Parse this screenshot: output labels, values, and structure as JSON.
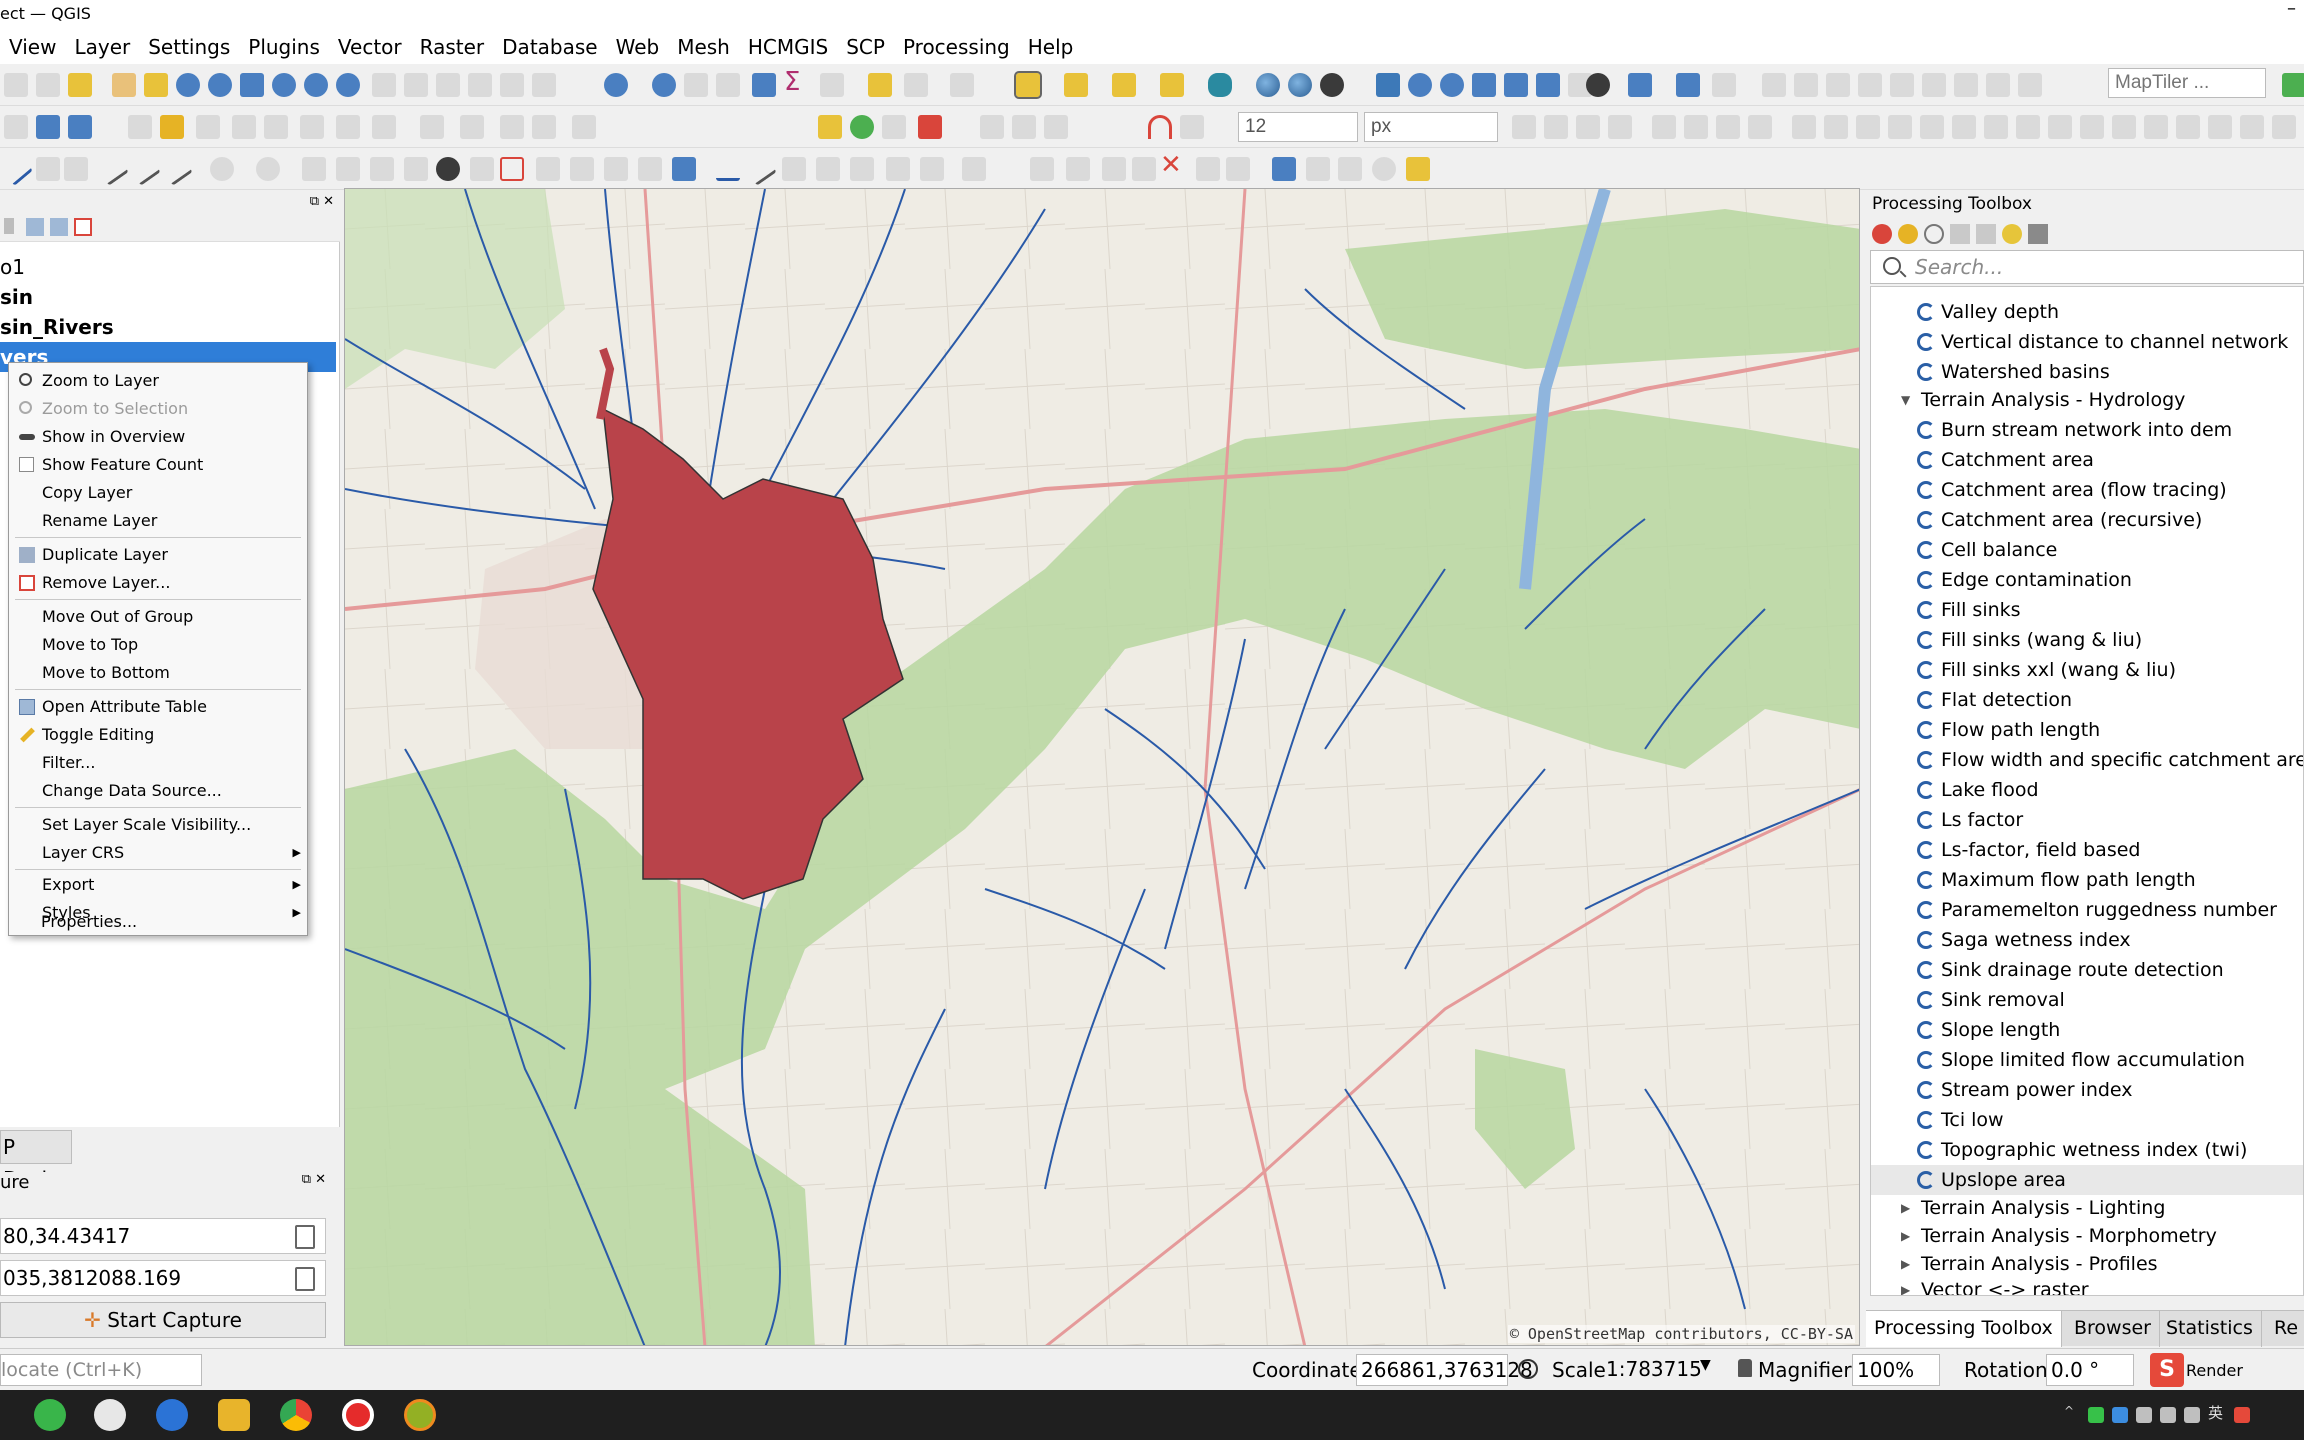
{
  "window": {
    "title": "ect — QGIS"
  },
  "menu": [
    "View",
    "Layer",
    "Settings",
    "Plugins",
    "Vector",
    "Raster",
    "Database",
    "Web",
    "Mesh",
    "HCMGIS",
    "SCP",
    "Processing",
    "Help"
  ],
  "toolbar": {
    "search_placeholder": "MapTiler ...",
    "font_size_value": "12",
    "unit_value": "px"
  },
  "layers": {
    "items": [
      {
        "label": "o1"
      },
      {
        "label": "sin"
      },
      {
        "label": "sin_Rivers"
      },
      {
        "label": "vers"
      }
    ]
  },
  "context_menu": {
    "items": [
      {
        "label": "Zoom to Layer"
      },
      {
        "label": "Zoom to Selection"
      },
      {
        "label": "Show in Overview"
      },
      {
        "label": "Show Feature Count"
      },
      {
        "label": "Copy Layer"
      },
      {
        "label": "Rename Layer"
      },
      {
        "label": "Duplicate Layer"
      },
      {
        "label": "Remove Layer..."
      },
      {
        "label": "Move Out of Group"
      },
      {
        "label": "Move to Top"
      },
      {
        "label": "Move to Bottom"
      },
      {
        "label": "Open Attribute Table"
      },
      {
        "label": "Toggle Editing"
      },
      {
        "label": "Filter..."
      },
      {
        "label": "Change Data Source..."
      },
      {
        "label": "Set Layer Scale Visibility..."
      },
      {
        "label": "Layer CRS"
      },
      {
        "label": "Export"
      },
      {
        "label": "Styles"
      },
      {
        "label": "Properties..."
      }
    ]
  },
  "dock": {
    "tab_label": "P Dock"
  },
  "capture": {
    "title": "ure",
    "field1": "80,34.43417",
    "field2": "035,3812088.169",
    "start_label": "Start Capture"
  },
  "map": {
    "attribution": "© OpenStreetMap contributors, CC-BY-SA"
  },
  "toolbox": {
    "title": "Processing Toolbox",
    "search_placeholder": "Search...",
    "items_top": [
      "Valley depth",
      "Vertical distance to channel network",
      "Watershed basins"
    ],
    "group_hydrology": "Terrain Analysis - Hydrology",
    "hydrology_items": [
      "Burn stream network into dem",
      "Catchment area",
      "Catchment area (flow tracing)",
      "Catchment area (recursive)",
      "Cell balance",
      "Edge contamination",
      "Fill sinks",
      "Fill sinks (wang & liu)",
      "Fill sinks xxl (wang & liu)",
      "Flat detection",
      "Flow path length",
      "Flow width and specific catchment area",
      "Lake flood",
      "Ls factor",
      "Ls-factor, field based",
      "Maximum flow path length",
      "Paramemelton ruggedness number",
      "Saga wetness index",
      "Sink drainage route detection",
      "Sink removal",
      "Slope length",
      "Slope limited flow accumulation",
      "Stream power index",
      "Tci low",
      "Topographic wetness index (twi)",
      "Upslope area"
    ],
    "groups_bottom": [
      "Terrain Analysis - Lighting",
      "Terrain Analysis - Morphometry",
      "Terrain Analysis - Profiles",
      "Vector <-> raster"
    ],
    "tabs": [
      "Processing Toolbox",
      "Browser",
      "Statistics",
      "Re"
    ]
  },
  "status": {
    "locate_placeholder": "locate (Ctrl+K)",
    "coordinate_label": "Coordinate",
    "coordinate_value": "266861,3763128",
    "scale_label": "Scale",
    "scale_value": "1:783715",
    "magnifier_label": "Magnifier",
    "magnifier_value": "100%",
    "rotation_label": "Rotation",
    "rotation_value": "0.0 °",
    "render_label": "Render"
  },
  "colors": {
    "selection": "#2f7ed8",
    "basin_fill": "#b9434a",
    "river": "#2a5aa8",
    "forest": "#a8d08d"
  }
}
